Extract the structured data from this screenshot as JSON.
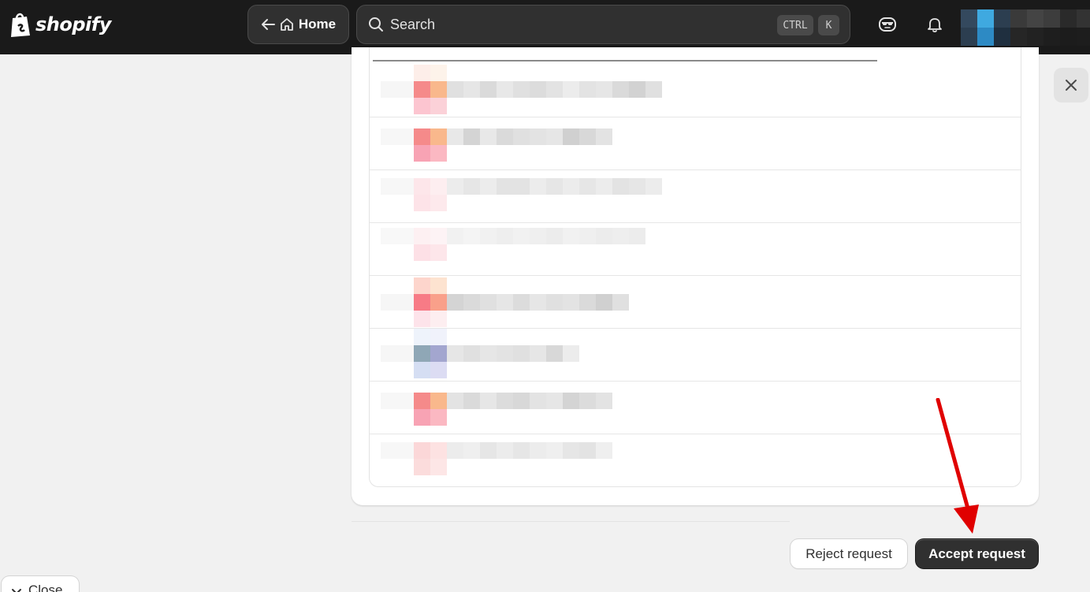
{
  "topbar": {
    "brand": "shopify",
    "home_label": "Home",
    "search_placeholder": "Search",
    "shortcut_ctrl": "CTRL",
    "shortcut_key": "K"
  },
  "icons": {
    "back": "arrow-left-icon",
    "home": "home-icon",
    "search": "search-icon",
    "sidekick": "sidekick-icon",
    "notifications": "bell-icon",
    "close": "close-icon",
    "chevron": "chevron-down-icon"
  },
  "colors": {
    "topbar_bg": "#1a1a1a",
    "primary_button": "#303030",
    "annotation_arrow": "#e00000",
    "avatar_accent": "#3fa9e0"
  },
  "actions": {
    "reject_label": "Reject request",
    "accept_label": "Accept request"
  },
  "footer": {
    "close_label": "Close"
  }
}
